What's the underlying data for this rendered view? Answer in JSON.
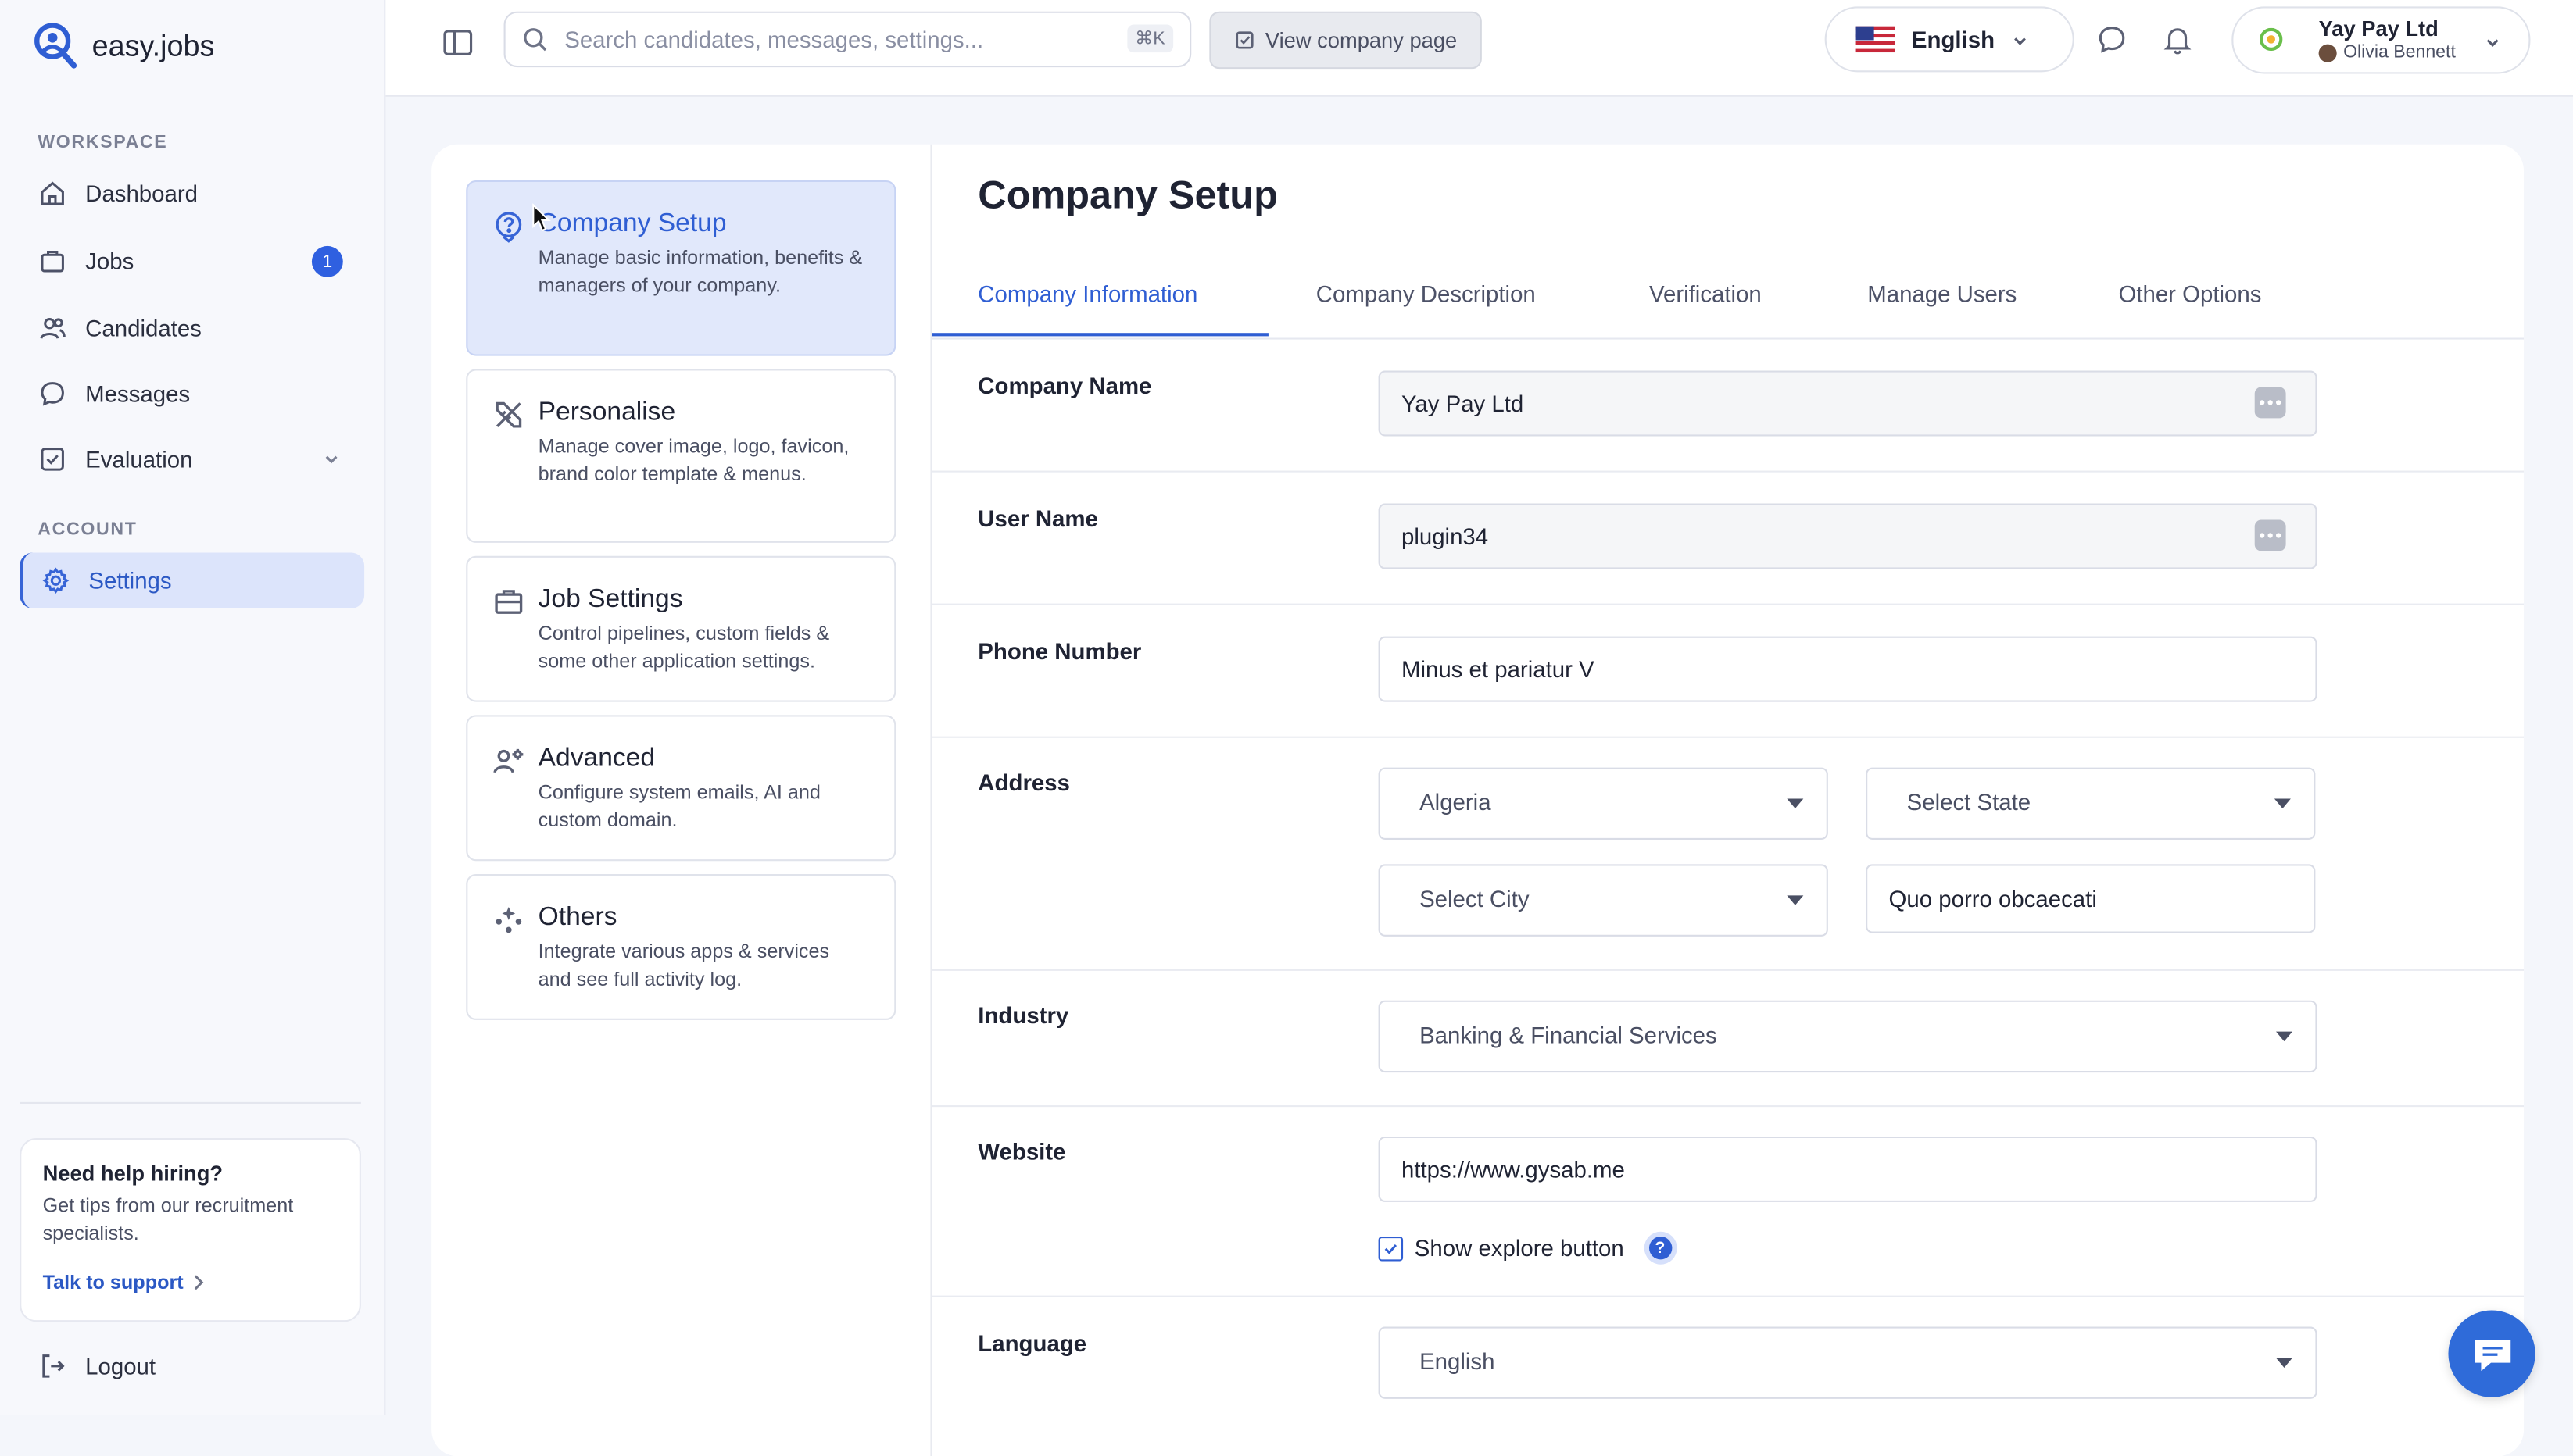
{
  "app": {
    "logo_text": "easy.jobs"
  },
  "sidebar": {
    "workspace_label": "WORKSPACE",
    "account_label": "ACCOUNT",
    "items": [
      {
        "label": "Dashboard",
        "icon": "home-icon"
      },
      {
        "label": "Jobs",
        "icon": "briefcase-icon",
        "badge": "1"
      },
      {
        "label": "Candidates",
        "icon": "users-icon"
      },
      {
        "label": "Messages",
        "icon": "chat-icon"
      },
      {
        "label": "Evaluation",
        "icon": "checklist-icon"
      }
    ],
    "settings_label": "Settings",
    "help": {
      "title": "Need help hiring?",
      "text": "Get tips from our recruitment specialists.",
      "link": "Talk to support"
    },
    "logout_label": "Logout"
  },
  "topbar": {
    "search_placeholder": "Search candidates, messages, settings...",
    "shortcut": "⌘K",
    "view_company_label": "View company page",
    "language": "English",
    "account_company": "Yay Pay Ltd",
    "account_user": "Olivia Bennett"
  },
  "settings_nav": [
    {
      "title": "Company Setup",
      "desc": "Manage basic information, benefits & managers of your company.",
      "icon": "question-circle-icon"
    },
    {
      "title": "Personalise",
      "desc": "Manage cover image, logo, favicon, brand color template & menus.",
      "icon": "brush-ruler-icon"
    },
    {
      "title": "Job Settings",
      "desc": "Control pipelines, custom fields & some other application settings.",
      "icon": "toolbox-icon"
    },
    {
      "title": "Advanced",
      "desc": "Configure system emails, AI and custom domain.",
      "icon": "user-gear-icon"
    },
    {
      "title": "Others",
      "desc": "Integrate various apps & services and see full activity log.",
      "icon": "sparkle-grid-icon"
    }
  ],
  "main": {
    "title": "Company Setup",
    "tabs": [
      "Company Information",
      "Company Description",
      "Verification",
      "Manage Users",
      "Other Options"
    ],
    "form": {
      "company_name_label": "Company Name",
      "company_name": "Yay Pay Ltd",
      "user_name_label": "User Name",
      "user_name": "plugin34",
      "phone_label": "Phone Number",
      "phone": "Minus et pariatur V",
      "address_label": "Address",
      "country": "Algeria",
      "state": "Select State",
      "city": "Select City",
      "street": "Quo porro obcaecati",
      "industry_label": "Industry",
      "industry": "Banking & Financial Services",
      "website_label": "Website",
      "website": "https://www.gysab.me",
      "show_explore_label": "Show explore button",
      "help_mark": "?",
      "language_label": "Language",
      "language": "English"
    }
  },
  "colors": {
    "accent": "#2f5ed3",
    "active_bg": "#e1e8fb",
    "chat_button": "#2f6bd9"
  }
}
